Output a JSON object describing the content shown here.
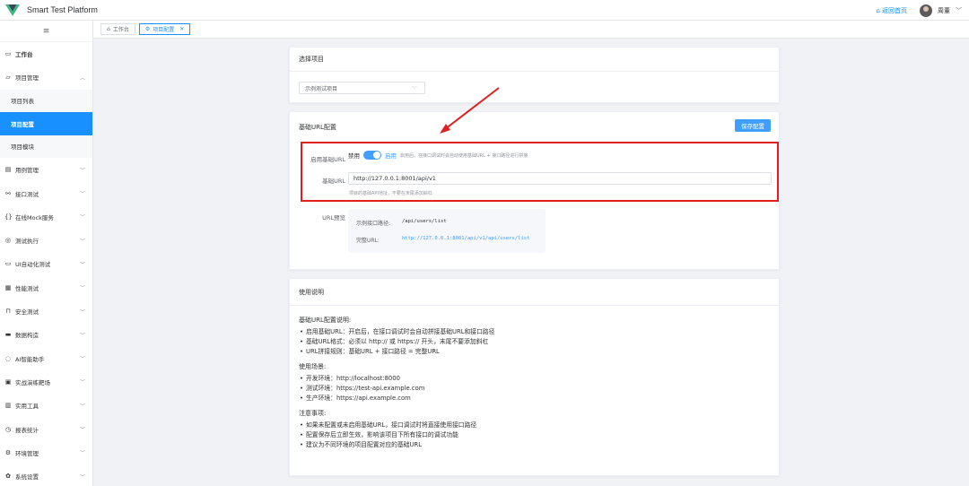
{
  "app": {
    "title": "Smart Test Platform"
  },
  "header": {
    "home_link": "返回首页",
    "user_name": "周董"
  },
  "sidebar": {
    "collapse_icon": "menu-icon",
    "items": [
      {
        "label": "工作台",
        "icon": "monitor-icon",
        "bold": true
      },
      {
        "label": "项目管理",
        "icon": "folder-icon",
        "expanded": true
      },
      {
        "label": "用例管理",
        "icon": "doc-icon"
      },
      {
        "label": "接口测试",
        "icon": "link-icon"
      },
      {
        "label": "在线Mock服务",
        "icon": "braces-icon"
      },
      {
        "label": "测试执行",
        "icon": "play-icon"
      },
      {
        "label": "UI自动化测试",
        "icon": "screen-icon"
      },
      {
        "label": "性能测试",
        "icon": "chart-icon"
      },
      {
        "label": "安全测试",
        "icon": "lock-icon"
      },
      {
        "label": "数据构造",
        "icon": "data-icon"
      },
      {
        "label": "AI智能助手",
        "icon": "chat-icon"
      },
      {
        "label": "实战演练靶场",
        "icon": "target-icon"
      },
      {
        "label": "实用工具",
        "icon": "toolbox-icon"
      },
      {
        "label": "报表统计",
        "icon": "clock-icon"
      },
      {
        "label": "环境管理",
        "icon": "gear-icon"
      },
      {
        "label": "系统设置",
        "icon": "settings-icon"
      }
    ],
    "sub_items": [
      "项目列表",
      "项目配置",
      "项目模块"
    ]
  },
  "tabs": [
    {
      "label": "工作台",
      "icon": "home-icon",
      "active": false
    },
    {
      "label": "项目配置",
      "icon": "gear-icon",
      "active": true
    }
  ],
  "project_card": {
    "title": "选择项目",
    "select_value": "示例测试项目"
  },
  "base_url_card": {
    "title": "基础URL配置",
    "save_label": "保存配置",
    "enable_label": "启用基础URL",
    "disabled_text": "禁用",
    "enabled_text": "启用",
    "enable_hint": "启用后，在接口调试时会自动使用基础URL + 接口路径进行拼接",
    "enabled": true,
    "url_label": "基础URL",
    "url_value": "http://127.0.0.1:8001/api/v1",
    "url_hint": "项目的基础API地址，不要在末尾添加斜杠",
    "preview_label": "URL预览",
    "example_path_label": "示例接口路径:",
    "example_path_value": "/api/users/list",
    "full_url_label": "完整URL:",
    "full_url_value": "http://127.0.0.1:8001/api/v1/api/users/list"
  },
  "usage_card": {
    "title": "使用说明",
    "sections": [
      {
        "heading": "基础URL配置说明:",
        "items": [
          "启用基础URL：开启后，在接口调试时会自动拼接基础URL和接口路径",
          "基础URL格式：必须以 http:// 或 https:// 开头，末尾不要添加斜杠",
          "URL拼接规则：基础URL + 接口路径 = 完整URL"
        ]
      },
      {
        "heading": "使用场景:",
        "items": [
          "开发环境：http://localhost:8000",
          "测试环境：https://test-api.example.com",
          "生产环境：https://api.example.com"
        ]
      },
      {
        "heading": "注意事项:",
        "items": [
          "如果未配置或未启用基础URL，接口调试时将直接使用接口路径",
          "配置保存后立即生效，影响该项目下所有接口的调试功能",
          "建议为不同环境的项目配置对应的基础URL"
        ]
      }
    ]
  },
  "colors": {
    "accent": "#409eff",
    "sidebar_active": "#1890ff",
    "highlight": "#e02020",
    "logo": "#41b883"
  }
}
